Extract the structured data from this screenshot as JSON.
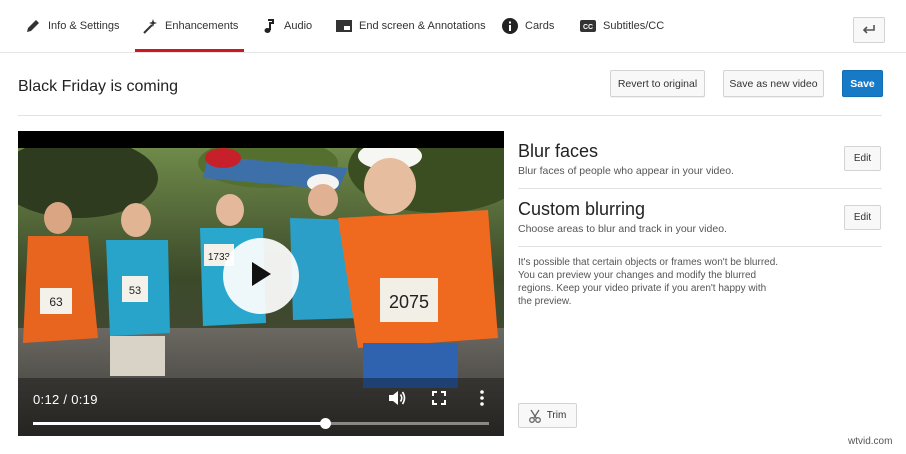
{
  "tabs": [
    {
      "label": "Info & Settings",
      "icon": "pencil-icon"
    },
    {
      "label": "Enhancements",
      "icon": "magic-wand-icon",
      "active": true
    },
    {
      "label": "Audio",
      "icon": "music-note-icon"
    },
    {
      "label": "End screen & Annotations",
      "icon": "end-screen-icon"
    },
    {
      "label": "Cards",
      "icon": "info-icon"
    },
    {
      "label": "Subtitles/CC",
      "icon": "cc-icon"
    }
  ],
  "header": {
    "title": "Black Friday is coming",
    "revert_label": "Revert to original",
    "save_new_label": "Save as new video",
    "save_label": "Save"
  },
  "player": {
    "time": "0:12 / 0:19",
    "progress": 0.64,
    "bib_numbers": [
      "1733",
      "2075",
      "63",
      "53"
    ]
  },
  "blur_faces": {
    "title": "Blur faces",
    "desc": "Blur faces of people who appear in your video.",
    "edit_label": "Edit"
  },
  "custom_blurring": {
    "title": "Custom blurring",
    "desc": "Choose areas to blur and track in your video.",
    "edit_label": "Edit"
  },
  "note": "It's possible that certain objects or frames won't be blurred. You can preview your changes and modify the blurred regions. Keep your video private if you aren't happy with the preview.",
  "trim_label": "Trim",
  "watermark": "wtvid.com",
  "colors": {
    "accent_red": "#cc181e",
    "primary_blue": "#167ac6"
  }
}
